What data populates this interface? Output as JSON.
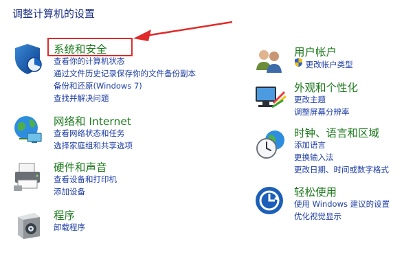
{
  "page_title": "调整计算机的设置",
  "left": [
    {
      "id": "system-security",
      "title": "系统和安全",
      "links": [
        "查看你的计算机状态",
        "通过文件历史记录保存你的文件备份副本",
        "备份和还原(Windows 7)",
        "查找并解决问题"
      ]
    },
    {
      "id": "network-internet",
      "title": "网络和 Internet",
      "links": [
        "查看网络状态和任务",
        "选择家庭组和共享选项"
      ]
    },
    {
      "id": "hardware-sound",
      "title": "硬件和声音",
      "links": [
        "查看设备和打印机",
        "添加设备"
      ]
    },
    {
      "id": "programs",
      "title": "程序",
      "links": [
        "卸载程序"
      ]
    }
  ],
  "right": [
    {
      "id": "user-accounts",
      "title": "用户帐户",
      "links": [
        "更改帐户类型"
      ]
    },
    {
      "id": "appearance",
      "title": "外观和个性化",
      "links": [
        "更改主题",
        "调整屏幕分辨率"
      ]
    },
    {
      "id": "clock-language",
      "title": "时钟、语言和区域",
      "links": [
        "添加语言",
        "更换输入法",
        "更改日期、时间或数字格式"
      ]
    },
    {
      "id": "ease-of-access",
      "title": "轻松使用",
      "links": [
        "使用 Windows 建议的设置",
        "优化视觉显示"
      ]
    }
  ],
  "colors": {
    "title_blue": "#1e3287",
    "category_green": "#1c7a1c",
    "link_blue": "#1e3ea6",
    "annotation_red": "#e02a2a"
  },
  "icons": [
    "shield-icon",
    "globe-network-icon",
    "printer-icon",
    "programs-box-icon",
    "users-icon",
    "monitor-paint-icon",
    "clock-globe-icon",
    "ease-of-access-icon",
    "uac-shield-icon"
  ]
}
